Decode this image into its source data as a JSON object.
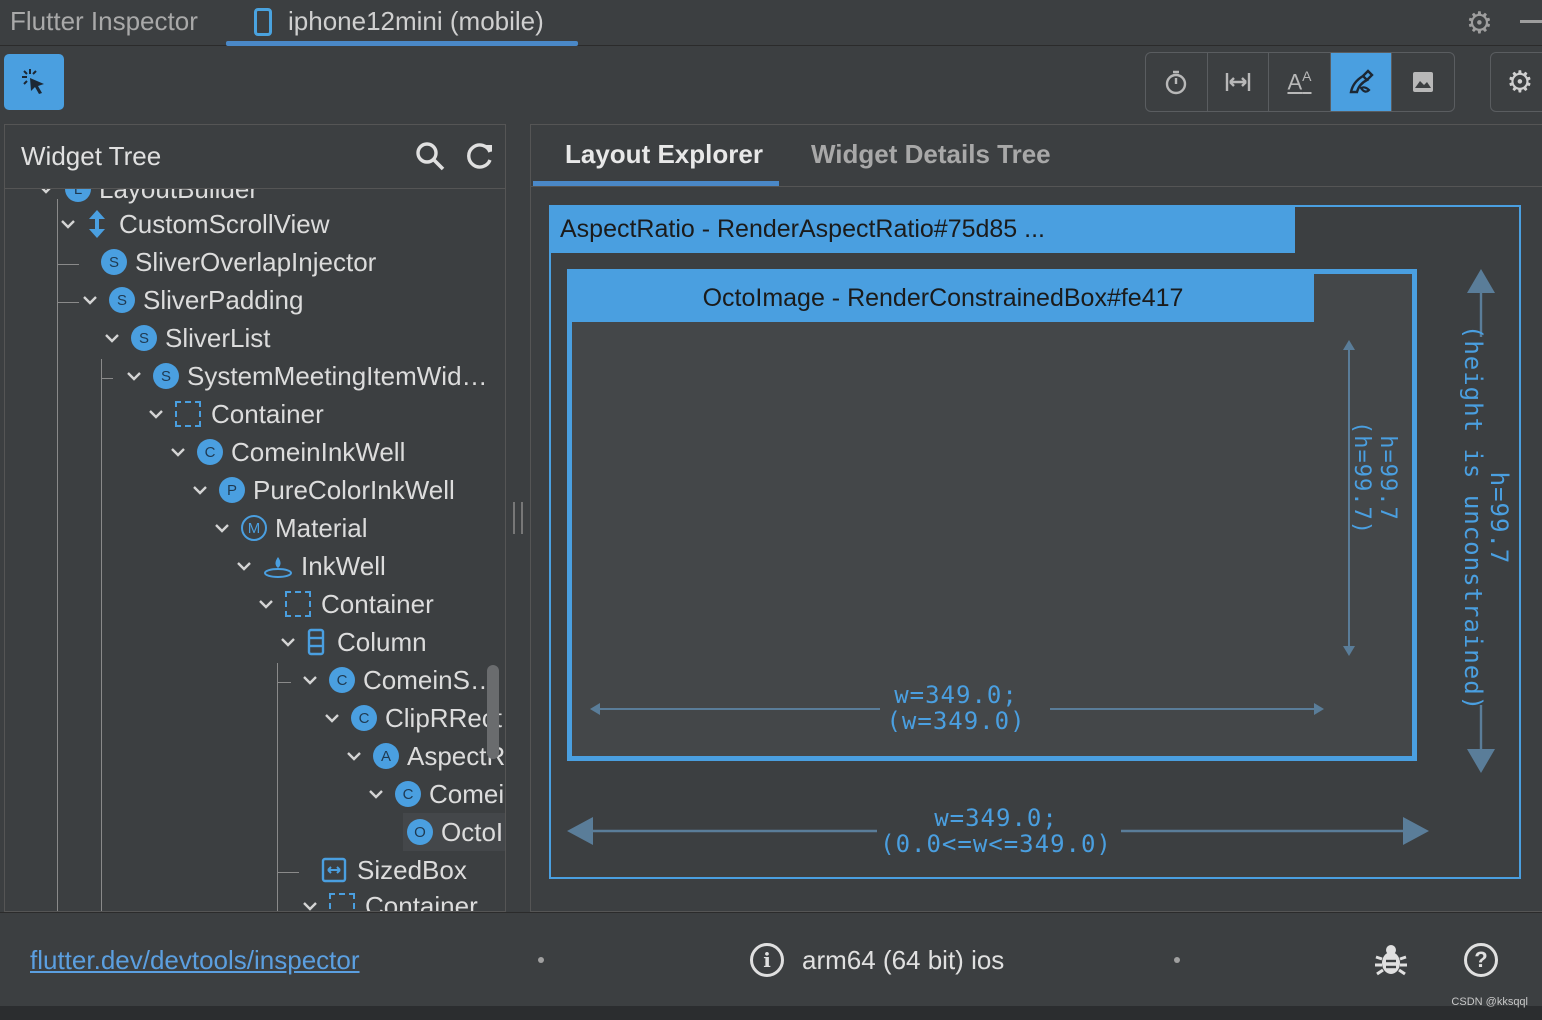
{
  "app": {
    "title": "Flutter Inspector"
  },
  "device_tab": {
    "label": "iphone12mini (mobile)"
  },
  "toolbar": {
    "icons": [
      "select-widget-mode-icon",
      "stopwatch-icon",
      "width-guidelines-icon",
      "text-baseline-icon",
      "repaint-rainbow-icon",
      "image-icon",
      "settings-icon"
    ]
  },
  "widget_tree": {
    "title": "Widget Tree",
    "rows": [
      {
        "label": "LayoutBuilder",
        "badge": "L"
      },
      {
        "label": "CustomScrollView",
        "badge": ""
      },
      {
        "label": "SliverOverlapInjector",
        "badge": "S"
      },
      {
        "label": "SliverPadding",
        "badge": "S"
      },
      {
        "label": "SliverList",
        "badge": "S"
      },
      {
        "label": "SystemMeetingItemWid…",
        "badge": "S"
      },
      {
        "label": "Container",
        "badge": ""
      },
      {
        "label": "ComeinInkWell",
        "badge": "C"
      },
      {
        "label": "PureColorInkWell",
        "badge": "P"
      },
      {
        "label": "Material",
        "badge": "M"
      },
      {
        "label": "InkWell",
        "badge": ""
      },
      {
        "label": "Container",
        "badge": ""
      },
      {
        "label": "Column",
        "badge": ""
      },
      {
        "label": "ComeinS…",
        "badge": "C"
      },
      {
        "label": "ClipRRect",
        "badge": "C"
      },
      {
        "label": "AspectRa",
        "badge": "A"
      },
      {
        "label": "Comeir",
        "badge": "C"
      },
      {
        "label": "OctoI",
        "badge": "O"
      },
      {
        "label": "SizedBox",
        "badge": ""
      },
      {
        "label": "Container",
        "badge": ""
      }
    ]
  },
  "details": {
    "tabs": [
      "Layout Explorer",
      "Widget Details Tree"
    ],
    "outer": {
      "title": "AspectRatio - RenderAspectRatio#75d85 ...",
      "height_line1": "h=99.7",
      "height_line2": "(height is unconstrained)",
      "width_line1": "w=349.0;",
      "width_line2": "(0.0<=w<=349.0)"
    },
    "inner": {
      "title": "OctoImage - RenderConstrainedBox#fe417",
      "height_line1": "h=99.7",
      "height_line2": "(h=99.7)",
      "width_line1": "w=349.0;",
      "width_line2": "(w=349.0)"
    }
  },
  "status": {
    "link": "flutter.dev/devtools/inspector",
    "platform": "arm64 (64 bit) ios",
    "info_glyph": "i",
    "help_glyph": "?"
  },
  "watermark": "CSDN @kksqql",
  "colors": {
    "accent": "#4a9fe0",
    "background": "#3c3f41",
    "link": "#5b9fe0"
  }
}
